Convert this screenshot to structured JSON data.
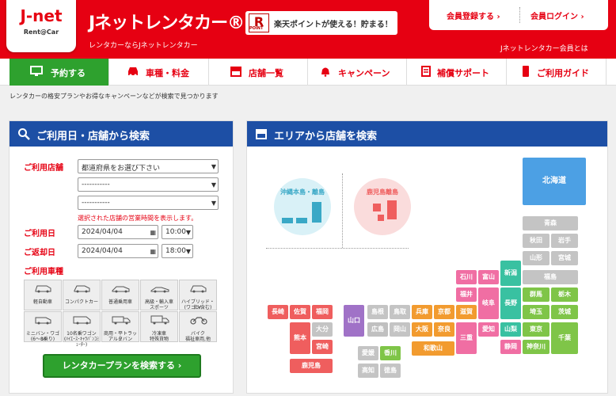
{
  "header": {
    "logo_text": "J-net",
    "logo_sub": "Rent@Car",
    "brand_title": "Jネットレンタカー®",
    "tagline": "レンタカーならJネットレンタカー",
    "rakuten_symbol": "R",
    "rakuten_point": "POINT",
    "rakuten_text": "楽天ポイントが使える！貯まる！",
    "member_register": "会員登録する ›",
    "member_login": "会員ログイン ›",
    "member_about": "Jネットレンタカー会員とは"
  },
  "nav": {
    "items": [
      {
        "label": "予約する",
        "icon": "monitor-icon"
      },
      {
        "label": "車種・料金",
        "icon": "car-icon"
      },
      {
        "label": "店舗一覧",
        "icon": "store-icon"
      },
      {
        "label": "キャンペーン",
        "icon": "bell-icon"
      },
      {
        "label": "補償サポート",
        "icon": "clipboard-icon"
      },
      {
        "label": "ご利用ガイド",
        "icon": "phone-icon"
      }
    ]
  },
  "note": "レンタカーの格安プランやお得なキャンペーンなどが検索で見つかります",
  "search": {
    "title": "ご利用日・店舗から検索",
    "store_label": "ご利用店舗",
    "pref_select": "都道府県をお選び下さい",
    "select2": "-----------",
    "select3": "-----------",
    "hint": "選択された店舗の営業時間を表示します。",
    "start_label": "ご利用日",
    "start_date": "2024/04/04",
    "start_time": "10:00",
    "return_label": "ご返却日",
    "return_date": "2024/04/04",
    "return_time": "18:00",
    "vehicle_label": "ご利用車種",
    "vehicles": [
      {
        "label": "軽自動車",
        "label2": ""
      },
      {
        "label": "コンパクトカー",
        "label2": ""
      },
      {
        "label": "普通乗用車",
        "label2": ""
      },
      {
        "label": "高級・輸入車",
        "label2": "スポーツ"
      },
      {
        "label": "ハイブリッド・EV",
        "label2": "(ワゴン含む)"
      },
      {
        "label": "ミニバン・ワゴン",
        "label2": "(6～8乗り)"
      },
      {
        "label": "10名乗ワゴン",
        "label2": "(ﾊｲｴｰｽ･ｷｬﾗﾊﾞﾝｺﾐｭｰﾀｰ)"
      },
      {
        "label": "商用・平トラック",
        "label2": "アルミバン"
      },
      {
        "label": "冷凍車",
        "label2": "特殊貨物"
      },
      {
        "label": "バイク",
        "label2": "福祉車両,他"
      }
    ],
    "button": "レンタカープランを検索する ›"
  },
  "area": {
    "title": "エリアから店舗を検索",
    "okinawa": "沖縄本島・離島",
    "kagoshima": "鹿児島離島",
    "prefs": {
      "hokkaido": "北海道",
      "aomori": "青森",
      "akita": "秋田",
      "iwate": "岩手",
      "yamagata": "山形",
      "miyagi": "宮城",
      "fukushima": "福島",
      "niigata": "新潟",
      "gunma": "群馬",
      "tochigi": "栃木",
      "nagano": "長野",
      "saitama": "埼玉",
      "ibaraki": "茨城",
      "yamanashi": "山梨",
      "tokyo": "東京",
      "chiba": "千葉",
      "kanagawa": "神奈川",
      "ishikawa": "石川",
      "toyama": "富山",
      "fukui": "福井",
      "gifu": "岐阜",
      "shizuoka": "静岡",
      "aichi": "愛知",
      "shiga": "滋賀",
      "mie": "三重",
      "kyoto": "京都",
      "hyogo": "兵庫",
      "osaka": "大阪",
      "nara": "奈良",
      "wakayama": "和歌山",
      "tottori": "鳥取",
      "shimane": "島根",
      "yamaguchi": "山口",
      "hiroshima": "広島",
      "okayama": "岡山",
      "ehime": "愛媛",
      "kagawa": "香川",
      "kochi": "高知",
      "tokushima": "徳島",
      "nagasaki": "長崎",
      "saga": "佐賀",
      "fukuoka": "福岡",
      "oita": "大分",
      "kumamoto": "熊本",
      "miyazaki": "宮崎",
      "kagoshima": "鹿児島"
    }
  }
}
